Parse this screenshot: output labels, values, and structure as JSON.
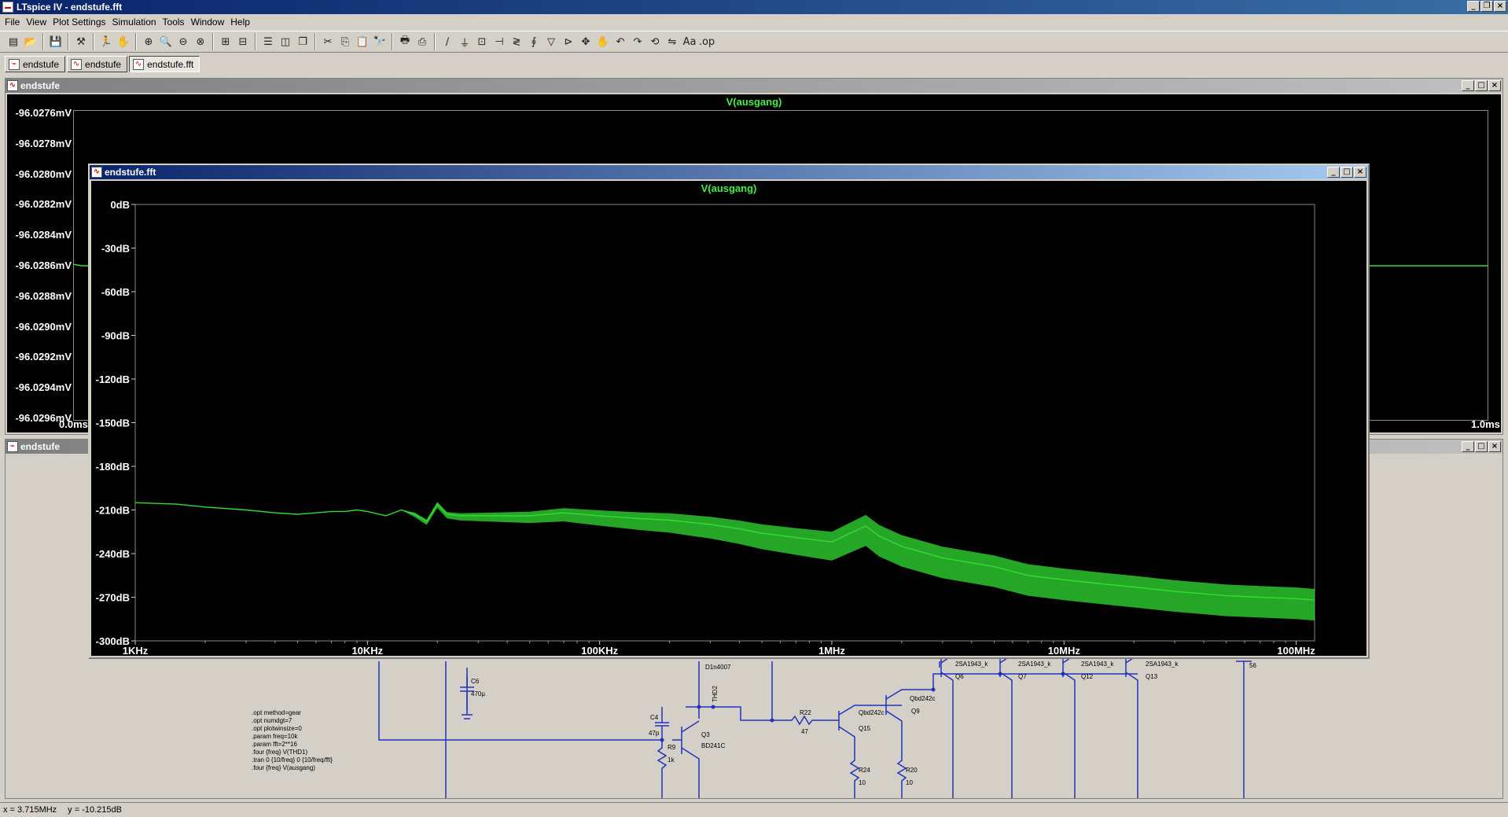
{
  "app": {
    "title": "LTspice IV - endstufe.fft"
  },
  "menu": [
    "File",
    "View",
    "Plot Settings",
    "Simulation",
    "Tools",
    "Window",
    "Help"
  ],
  "tabs": [
    {
      "label": "endstufe",
      "icon": "schematic-icon",
      "active": false
    },
    {
      "label": "endstufe",
      "icon": "waveform-icon",
      "active": false
    },
    {
      "label": "endstufe.fft",
      "icon": "waveform-icon",
      "active": true
    }
  ],
  "waveform_window": {
    "title": "endstufe",
    "trace": "V(ausgang)",
    "y_ticks": [
      "-96.0276mV",
      "-96.0278mV",
      "-96.0280mV",
      "-96.0282mV",
      "-96.0284mV",
      "-96.0286mV",
      "-96.0288mV",
      "-96.0290mV",
      "-96.0292mV",
      "-96.0294mV",
      "-96.0296mV"
    ],
    "x_start": "0.0ms",
    "x_end": "1.0ms",
    "trace_color": "#33dd33"
  },
  "schematic_window": {
    "title": "endstufe",
    "labels": {
      "c6": "C6",
      "c6_val": "470µ",
      "d1": "D1n4007",
      "thd": "THD2",
      "c4": "C4",
      "c4_val": "47p",
      "r9": "R9",
      "r9_val": "1k",
      "q3": "Q3",
      "q3_type": "BD241C",
      "r22": "R22",
      "r22_val": "47",
      "q15_type": "Qbd242c",
      "q15": "Q15",
      "q9_type": "Qbd242c",
      "q9": "Q9",
      "r24": "R24",
      "r24_val": "10",
      "r20": "R20",
      "r20_val": "10",
      "q6_type": "2SA1943_k",
      "q6": "Q6",
      "q7_type": "2SA1943_k",
      "q7": "Q7",
      "q12_type": "2SA1943_k",
      "q12": "Q12",
      "q13_type": "2SA1943_k",
      "q13": "Q13",
      "node56": "56"
    },
    "directives": [
      ".opt method=gear",
      ".opt numdgt=7",
      ".opt plotwinsize=0",
      ".param freq=10k",
      ".param fft=2**16",
      ".four {freq} V(THD1)",
      ".tran 0 {10/freq} 0 {10/freq/fft}",
      ".four {freq} V(ausgang)"
    ]
  },
  "fft_window": {
    "title": "endstufe.fft"
  },
  "chart_data": {
    "type": "line",
    "title": "V(ausgang)",
    "xlabel": "",
    "ylabel": "",
    "x_scale": "log",
    "xlim": [
      1000,
      120000000
    ],
    "ylim": [
      -300,
      0
    ],
    "x_ticks": [
      "1KHz",
      "10KHz",
      "100KHz",
      "1MHz",
      "10MHz",
      "100MHz"
    ],
    "y_ticks": [
      "0dB",
      "-30dB",
      "-60dB",
      "-90dB",
      "-120dB",
      "-150dB",
      "-180dB",
      "-210dB",
      "-240dB",
      "-270dB",
      "-300dB"
    ],
    "grid": false,
    "series": [
      {
        "color": "#33dd33",
        "x": [
          1000,
          1500,
          2000,
          3000,
          4000,
          5000,
          6000,
          7000,
          8000,
          9000,
          10000,
          12000,
          14000,
          16000,
          18000,
          20000,
          22000,
          25000,
          30000,
          40000,
          50000,
          70000,
          100000,
          150000,
          200000,
          300000,
          400000,
          500000,
          700000,
          1000000,
          1200000,
          1400000,
          1600000,
          2000000,
          3000000,
          5000000,
          7000000,
          10000000,
          15000000,
          20000000,
          30000000,
          50000000,
          70000000,
          100000000,
          120000000
        ],
        "y": [
          -205,
          -206,
          -208,
          -210,
          -212,
          -213,
          -212,
          -211,
          -211,
          -210,
          -211,
          -214,
          -210,
          -213,
          -218,
          -206,
          -213,
          -214,
          -214,
          -214,
          -214,
          -212,
          -214,
          -216,
          -217,
          -220,
          -223,
          -226,
          -229,
          -232,
          -226,
          -221,
          -228,
          -235,
          -243,
          -249,
          -255,
          -258,
          -261,
          -263,
          -266,
          -269,
          -270,
          -271,
          -272
        ]
      }
    ]
  },
  "status": {
    "x_readout": "x = 3.715MHz",
    "y_readout": "y = -10.215dB"
  }
}
